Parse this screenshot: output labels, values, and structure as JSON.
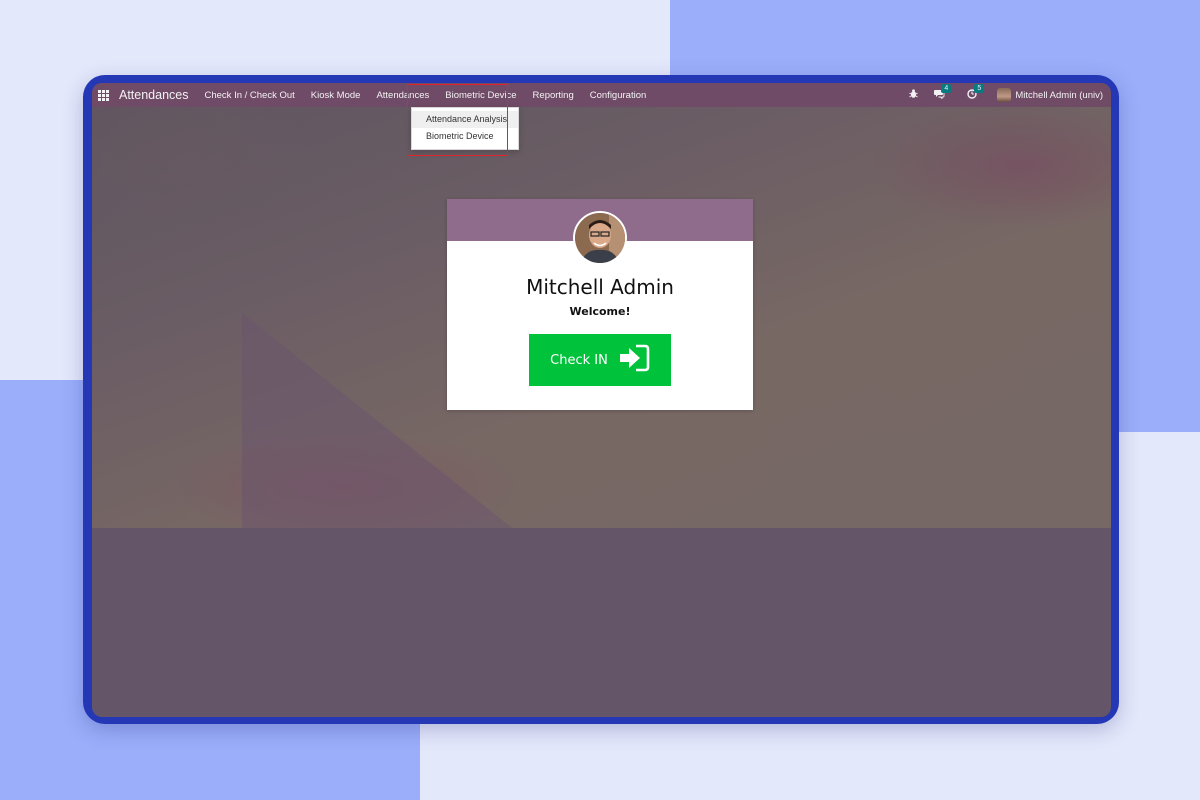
{
  "colors": {
    "navbar": "#714b67",
    "checkin_button": "#00c23b",
    "badge": "#017e84",
    "highlight": "#e0242d",
    "card_header": "#8f6b8c"
  },
  "navbar": {
    "apps_icon": "grid-icon",
    "brand": "Attendances",
    "menu": [
      "Check In / Check Out",
      "Kiosk Mode",
      "Attendances",
      "Biometric Device",
      "Reporting",
      "Configuration"
    ],
    "debug_icon": "bug-icon",
    "messages": {
      "icon": "chat-icon",
      "count": "4"
    },
    "activities": {
      "icon": "clock-icon",
      "count": "5"
    },
    "user": "Mitchell Admin (univ)"
  },
  "dropdown": {
    "items": [
      "Attendance Analysis",
      "Biometric Device"
    ]
  },
  "card": {
    "name": "Mitchell Admin",
    "welcome": "Welcome!",
    "button_label": "Check IN",
    "button_icon": "sign-in-icon"
  }
}
